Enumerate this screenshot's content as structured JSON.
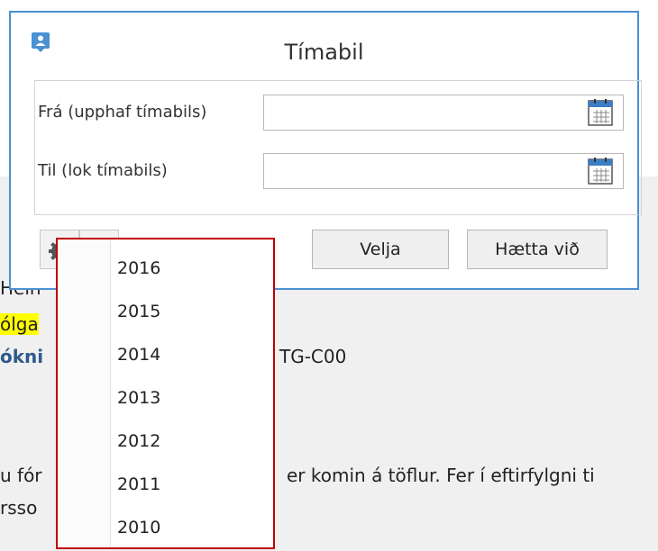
{
  "dialog": {
    "title": "Tímabil",
    "from_label": "Frá (upphaf tímabils)",
    "from_value": "",
    "to_label": "Til (lok tímabils)",
    "to_value": "",
    "select_label": "Velja",
    "cancel_label": "Hætta við"
  },
  "background_text": {
    "line1": "Hein",
    "line2": "ólga",
    "line3a": "ókni",
    "line3b": "TG-C00",
    "line4a": "u fór",
    "line4b": "er komin á töflur. Fer í eftirfylgni ti",
    "line5": "rsso"
  },
  "year_menu": {
    "items": [
      "2016",
      "2015",
      "2014",
      "2013",
      "2012",
      "2011",
      "2010"
    ]
  },
  "colors": {
    "dialog_border": "#4a90d2",
    "menu_border": "#c10000",
    "highlight": "#ffff00",
    "link": "#2e5a8c"
  }
}
